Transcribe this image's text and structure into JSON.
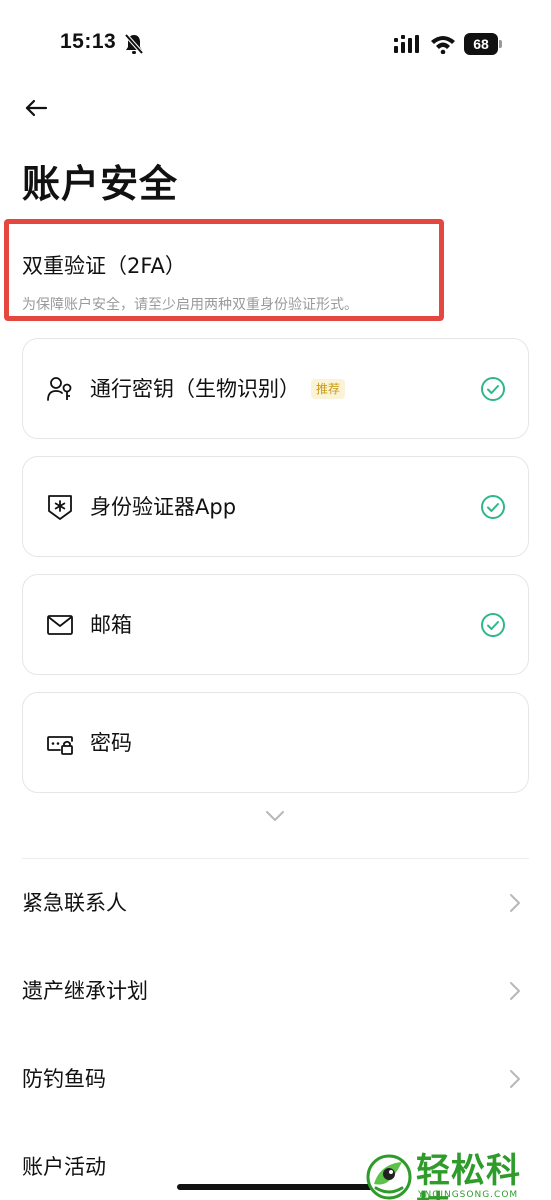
{
  "status": {
    "time": "15:13",
    "battery": "68"
  },
  "page": {
    "title": "账户安全"
  },
  "two_factor": {
    "heading": "双重验证（2FA）",
    "description": "为保障账户安全，请至少启用两种双重身份验证形式。"
  },
  "methods": [
    {
      "label": "通行密钥（生物识别）",
      "badge": "推荐",
      "icon": "passkey-user-icon",
      "enabled": true
    },
    {
      "label": "身份验证器App",
      "icon": "authenticator-shield-icon",
      "enabled": true
    },
    {
      "label": "邮箱",
      "icon": "mail-icon",
      "enabled": true
    },
    {
      "label": "密码",
      "icon": "password-lock-icon",
      "enabled": false
    }
  ],
  "menu": [
    {
      "label": "紧急联系人"
    },
    {
      "label": "遗产继承计划"
    },
    {
      "label": "防钓鱼码"
    },
    {
      "label": "账户活动"
    }
  ],
  "watermark": {
    "text": "轻松科技",
    "sub": "YNQINGSONG.COM"
  },
  "colors": {
    "accent_green": "#2eb88a",
    "highlight_red": "#e4473f",
    "badge_bg": "#fbf3d8",
    "badge_text": "#c89a14"
  }
}
